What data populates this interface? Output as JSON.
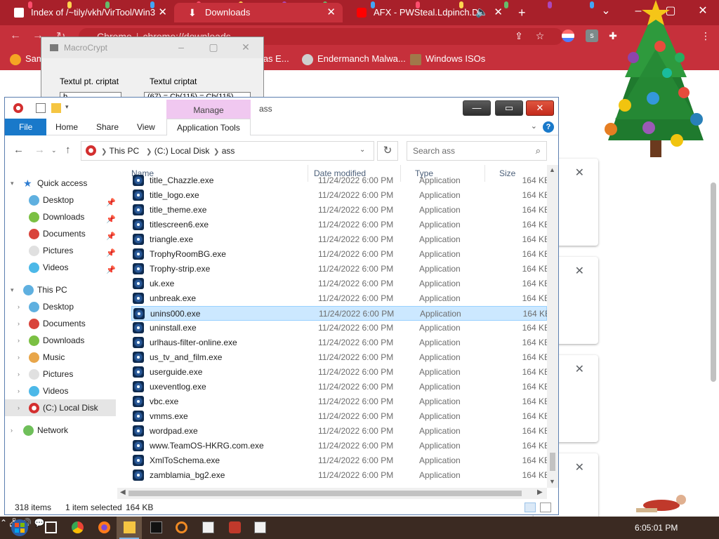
{
  "chrome": {
    "tabs": [
      {
        "label": "Index of /~tily/vkh/VirTool/Win3",
        "active": false
      },
      {
        "label": "Downloads",
        "active": true
      },
      {
        "label": "AFX - PWSteal.Ldpinch.D - ",
        "active": false
      }
    ],
    "omnibox": {
      "site": "Chrome",
      "url": "chrome://downloads"
    },
    "bookmarks": [
      {
        "label": "Sam"
      },
      {
        "label": "mas E..."
      },
      {
        "label": "Endermanch Malwa..."
      },
      {
        "label": "Windows ISOs"
      }
    ]
  },
  "macrocrypt": {
    "title": "MacroCrypt",
    "label_plain": "Textul pt. criptat",
    "label_cipher": "Textul criptat",
    "input_plain": "b",
    "input_cipher": "(67) = Ch(115) = Ch(115)"
  },
  "explorer": {
    "manage_label": "Manage",
    "title": "ass",
    "ribbon": {
      "file": "File",
      "home": "Home",
      "share": "Share",
      "view": "View",
      "app_tools": "Application Tools"
    },
    "address": {
      "root": "This PC",
      "disk": "(C:) Local Disk",
      "folder": "ass"
    },
    "search_placeholder": "Search ass",
    "nav": {
      "quick_access": "Quick access",
      "qa_items": [
        "Desktop",
        "Downloads",
        "Documents",
        "Pictures",
        "Videos"
      ],
      "this_pc": "This PC",
      "pc_items": [
        "Desktop",
        "Documents",
        "Downloads",
        "Music",
        "Pictures",
        "Videos",
        "(C:) Local Disk"
      ],
      "network": "Network"
    },
    "columns": {
      "name": "Name",
      "date": "Date modified",
      "type": "Type",
      "size": "Size"
    },
    "files": [
      {
        "name": "title_Chazzle.exe",
        "date": "11/24/2022 6:00 PM",
        "type": "Application",
        "size": "164 KB"
      },
      {
        "name": "title_logo.exe",
        "date": "11/24/2022 6:00 PM",
        "type": "Application",
        "size": "164 KB"
      },
      {
        "name": "title_theme.exe",
        "date": "11/24/2022 6:00 PM",
        "type": "Application",
        "size": "164 KB"
      },
      {
        "name": "titlescreen6.exe",
        "date": "11/24/2022 6:00 PM",
        "type": "Application",
        "size": "164 KB"
      },
      {
        "name": "triangle.exe",
        "date": "11/24/2022 6:00 PM",
        "type": "Application",
        "size": "164 KB"
      },
      {
        "name": "TrophyRoomBG.exe",
        "date": "11/24/2022 6:00 PM",
        "type": "Application",
        "size": "164 KB"
      },
      {
        "name": "Trophy-strip.exe",
        "date": "11/24/2022 6:00 PM",
        "type": "Application",
        "size": "164 KB"
      },
      {
        "name": "uk.exe",
        "date": "11/24/2022 6:00 PM",
        "type": "Application",
        "size": "164 KB"
      },
      {
        "name": "unbreak.exe",
        "date": "11/24/2022 6:00 PM",
        "type": "Application",
        "size": "164 KB"
      },
      {
        "name": "unins000.exe",
        "date": "11/24/2022 6:00 PM",
        "type": "Application",
        "size": "164 KB",
        "selected": true
      },
      {
        "name": "uninstall.exe",
        "date": "11/24/2022 6:00 PM",
        "type": "Application",
        "size": "164 KB"
      },
      {
        "name": "urlhaus-filter-online.exe",
        "date": "11/24/2022 6:00 PM",
        "type": "Application",
        "size": "164 KB"
      },
      {
        "name": "us_tv_and_film.exe",
        "date": "11/24/2022 6:00 PM",
        "type": "Application",
        "size": "164 KB"
      },
      {
        "name": "userguide.exe",
        "date": "11/24/2022 6:00 PM",
        "type": "Application",
        "size": "164 KB"
      },
      {
        "name": "uxeventlog.exe",
        "date": "11/24/2022 6:00 PM",
        "type": "Application",
        "size": "164 KB"
      },
      {
        "name": "vbc.exe",
        "date": "11/24/2022 6:00 PM",
        "type": "Application",
        "size": "164 KB"
      },
      {
        "name": "vmms.exe",
        "date": "11/24/2022 6:00 PM",
        "type": "Application",
        "size": "164 KB"
      },
      {
        "name": "wordpad.exe",
        "date": "11/24/2022 6:00 PM",
        "type": "Application",
        "size": "164 KB"
      },
      {
        "name": "www.TeamOS-HKRG.com.exe",
        "date": "11/24/2022 6:00 PM",
        "type": "Application",
        "size": "164 KB"
      },
      {
        "name": "XmlToSchema.exe",
        "date": "11/24/2022 6:00 PM",
        "type": "Application",
        "size": "164 KB"
      },
      {
        "name": "zamblamia_bg2.exe",
        "date": "11/24/2022 6:00 PM",
        "type": "Application",
        "size": "164 KB"
      }
    ],
    "status": {
      "count": "318 items",
      "selected": "1 item selected",
      "size": "164 KB"
    }
  },
  "taskbar": {
    "time": "6:05:01 PM"
  },
  "colors": {
    "chrome_red": "#c6303b",
    "file_tab_blue": "#1979ca",
    "selection": "#cce8ff",
    "manage_pink": "#f0c8f0"
  }
}
